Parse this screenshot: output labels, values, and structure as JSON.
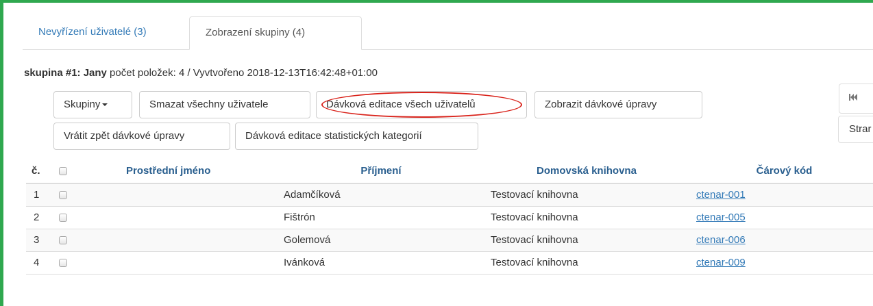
{
  "tabs": [
    {
      "label": "Nevyřízení uživatelé (3)",
      "active": false
    },
    {
      "label": "Zobrazení skupiny (4)",
      "active": true
    }
  ],
  "group": {
    "prefix": "skupina #1: Jany",
    "detail": " počet položek: 4 / Vyvtvořeno 2018-12-13T16:42:48+01:00"
  },
  "toolbar": {
    "groups_label": "Skupiny",
    "delete_all_label": "Smazat všechny uživatele",
    "batch_edit_all_label": "Dávková editace všech uživatelů",
    "show_batch_changes_label": "Zobrazit dávkové úpravy",
    "revert_batch_label": "Vrátit zpět dávkové úpravy",
    "batch_edit_stat_label": "Dávková editace statistických kategorií"
  },
  "pager": {
    "first_icon": "first-page-icon",
    "label": "Strar"
  },
  "colors": {
    "frame": "#2fa84f",
    "highlight": "#d9231b",
    "link": "#337ab7",
    "header": "#2a5f8f"
  },
  "table": {
    "headers": {
      "num": "č.",
      "middle_name": "Prostřední jméno",
      "surname": "Příjmení",
      "library": "Domovská knihovna",
      "barcode": "Čárový kód"
    },
    "rows": [
      {
        "num": "1",
        "middle_name": "",
        "surname": "Adamčíková",
        "library": "Testovací knihovna",
        "barcode": "ctenar-001"
      },
      {
        "num": "2",
        "middle_name": "",
        "surname": "Fištrón",
        "library": "Testovací knihovna",
        "barcode": "ctenar-005"
      },
      {
        "num": "3",
        "middle_name": "",
        "surname": "Golemová",
        "library": "Testovací knihovna",
        "barcode": "ctenar-006"
      },
      {
        "num": "4",
        "middle_name": "",
        "surname": "Ivánková",
        "library": "Testovací knihovna",
        "barcode": "ctenar-009"
      }
    ]
  }
}
